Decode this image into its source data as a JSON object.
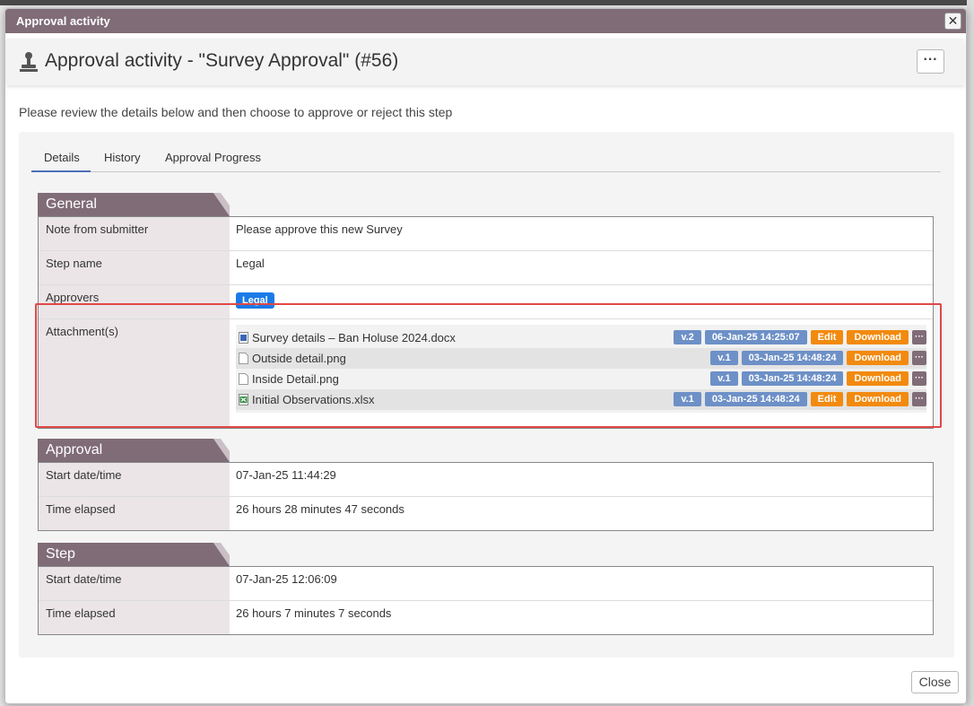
{
  "dialog": {
    "window_title": "Approval activity",
    "close_glyph": "✕",
    "heading": "Approval activity - \"Survey Approval\" (#56)",
    "more_glyph": "···",
    "intro": "Please review the details below and then choose to approve or reject this step",
    "close_button": "Close"
  },
  "tabs": [
    {
      "label": "Details",
      "active": true
    },
    {
      "label": "History",
      "active": false
    },
    {
      "label": "Approval Progress",
      "active": false
    }
  ],
  "general": {
    "title": "General",
    "note_label": "Note from submitter",
    "note_value": "Please approve this new Survey",
    "step_label": "Step name",
    "step_value": "Legal",
    "approvers_label": "Approvers",
    "approvers_value": "Legal",
    "attachments_label": "Attachment(s)",
    "attachments": [
      {
        "name": "Survey details – Ban Holuse 2024.docx",
        "icon": "word-doc-icon",
        "version": "v.2",
        "date": "06-Jan-25 14:25:07",
        "edit": "Edit",
        "download": "Download",
        "more": "···"
      },
      {
        "name": "Outside detail.png",
        "icon": "file-icon",
        "version": "v.1",
        "date": "03-Jan-25 14:48:24",
        "edit": "",
        "download": "Download",
        "more": "···"
      },
      {
        "name": "Inside Detail.png",
        "icon": "file-icon",
        "version": "v.1",
        "date": "03-Jan-25 14:48:24",
        "edit": "",
        "download": "Download",
        "more": "···"
      },
      {
        "name": "Initial Observations.xlsx",
        "icon": "excel-icon",
        "version": "v.1",
        "date": "03-Jan-25 14:48:24",
        "edit": "Edit",
        "download": "Download",
        "more": "···"
      }
    ]
  },
  "approval": {
    "title": "Approval",
    "start_label": "Start date/time",
    "start_value": "07-Jan-25 11:44:29",
    "elapsed_label": "Time elapsed",
    "elapsed_value": "26 hours 28 minutes 47 seconds"
  },
  "step": {
    "title": "Step",
    "start_label": "Start date/time",
    "start_value": "07-Jan-25 12:06:09",
    "elapsed_label": "Time elapsed",
    "elapsed_value": "26 hours 7 minutes 7 seconds"
  },
  "colors": {
    "brand": "#806c77",
    "accent_orange": "#f28a0f",
    "accent_blue": "#6d90c7",
    "pill_blue": "#1a7be8",
    "highlight_red": "#e04848"
  }
}
